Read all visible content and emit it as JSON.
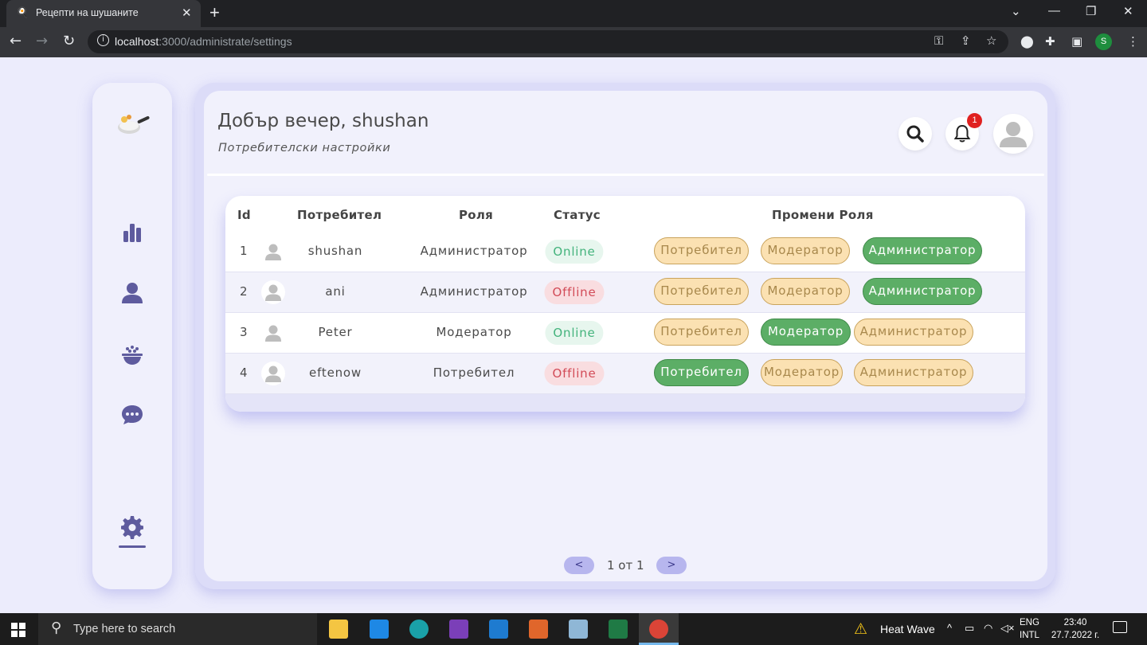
{
  "browser": {
    "tab_title": "Рецепти на шушаните",
    "url_host": "localhost",
    "url_path": ":3000/administrate/settings"
  },
  "header": {
    "greeting": "Добър вечер, shushan",
    "subtitle": "Потребителски настройки",
    "notification_count": "1"
  },
  "table": {
    "columns": [
      "Id",
      "Потребител",
      "Роля",
      "Статус",
      "Промени Роля"
    ],
    "rows": [
      {
        "id": "1",
        "user": "shushan",
        "role": "Администратор",
        "status": "Online",
        "status_type": "online",
        "active_role": "admin"
      },
      {
        "id": "2",
        "user": "ani",
        "role": "Администратор",
        "status": "Offline",
        "status_type": "offline",
        "active_role": "admin"
      },
      {
        "id": "3",
        "user": "Peter",
        "role": "Модератор",
        "status": "Online",
        "status_type": "online",
        "active_role": "moderator"
      },
      {
        "id": "4",
        "user": "eftenow",
        "role": "Потребител",
        "status": "Offline",
        "status_type": "offline",
        "active_role": "user"
      }
    ],
    "role_buttons": {
      "user": "Потребител",
      "moderator": "Модератор",
      "admin": "Администратор"
    }
  },
  "pagination": {
    "prev": "<",
    "next": ">",
    "text": "1 от 1"
  },
  "taskbar": {
    "search_placeholder": "Type here to search",
    "weather": "Heat Wave",
    "lang_top": "ENG",
    "lang_bottom": "INTL",
    "time": "23:40",
    "date": "27.7.2022 г."
  },
  "colors": {
    "accent": "#5e5b9e",
    "role_active": "#5cae66",
    "role_inactive": "#fbe1b2",
    "online": "#43b37c",
    "offline": "#d24b57"
  }
}
